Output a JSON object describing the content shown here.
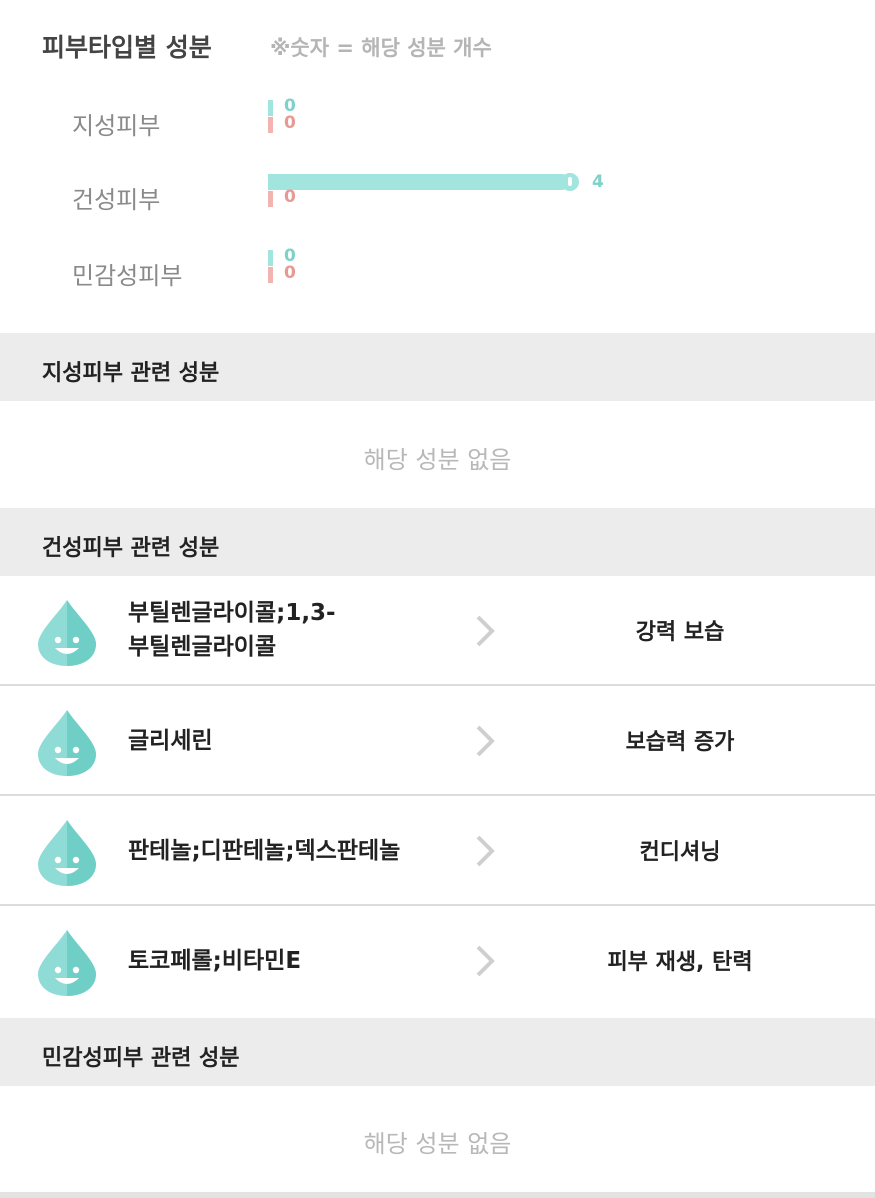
{
  "summary": {
    "title": "피부타입별 성분",
    "note": "※숫자 = 해당 성분 개수",
    "rows": [
      {
        "label": "지성피부",
        "good": 0,
        "bad": 0,
        "good_text": "0",
        "bad_text": "0"
      },
      {
        "label": "건성피부",
        "good": 4,
        "bad": 0,
        "good_text": "4",
        "bad_text": "0"
      },
      {
        "label": "민감성피부",
        "good": 0,
        "bad": 0,
        "good_text": "0",
        "bad_text": "0"
      }
    ],
    "colors": {
      "good": "#a2e4de",
      "bad": "#f2b4b0"
    }
  },
  "sections": {
    "oily": {
      "title": "지성피부 관련 성분",
      "empty": "해당 성분 없음"
    },
    "dry": {
      "title": "건성피부 관련 성분",
      "items": [
        {
          "name_line1": "부틸렌글라이콜;1,3-",
          "name_line2": "부틸렌글라이콜",
          "effect": "강력 보습",
          "icon": "water-drop-smile-icon"
        },
        {
          "name_line1": "글리세린",
          "name_line2": "",
          "effect": "보습력 증가",
          "icon": "water-drop-smile-icon"
        },
        {
          "name_line1": "판테놀;디판테놀;덱스판테놀",
          "name_line2": "",
          "effect": "컨디셔닝",
          "icon": "water-drop-smile-icon"
        },
        {
          "name_line1": "토코페롤;비타민E",
          "name_line2": "",
          "effect": "피부 재생, 탄력",
          "icon": "water-drop-smile-icon"
        }
      ]
    },
    "sensitive": {
      "title": "민감성피부 관련 성분",
      "empty": "해당 성분 없음"
    }
  }
}
